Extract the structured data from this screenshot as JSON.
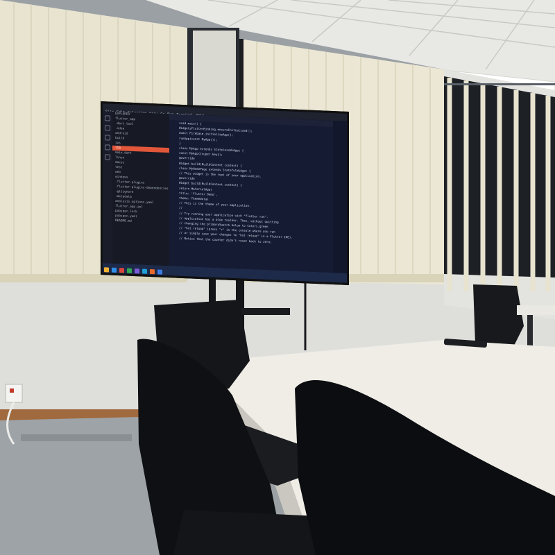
{
  "scene": {
    "description_colors": {
      "ceiling": "#e6e6e3",
      "wall": "#dcdcd8",
      "blinds": "#e8e3cf",
      "floor": "#9ea3a7",
      "table": "#efede6",
      "chair": "#111214",
      "baseboard": "#a0683c"
    }
  },
  "tv": {
    "menu": [
      "File",
      "Edit",
      "Selection",
      "View",
      "Go",
      "Run",
      "Terminal",
      "Help"
    ],
    "explorer_items": [
      "EXPLORER",
      "flutter_app",
      ".dart_tool",
      ".idea",
      "android",
      "build",
      "ios",
      "lib",
      "main.dart",
      "linux",
      "macos",
      "test",
      "web",
      "windows",
      ".flutter-plugins",
      ".flutter-plugins-dependencies",
      ".gitignore",
      ".metadata",
      "analysis_options.yaml",
      "flutter_app.iml",
      "pubspec.lock",
      "pubspec.yaml",
      "README.md"
    ],
    "code_lines": [
      {
        "cls": "k",
        "text": "void main() {"
      },
      {
        "cls": "f",
        "text": "  WidgetsFlutterBinding.ensureInitialized();"
      },
      {
        "cls": "f",
        "text": "  await Firebase.initializeApp();"
      },
      {
        "cls": "t",
        "text": "  runApp(const MyApp());"
      },
      {
        "cls": "k",
        "text": "}"
      },
      {
        "cls": "t",
        "text": "class MyApp extends StatelessWidget {"
      },
      {
        "cls": "f",
        "text": "  const MyApp({super.key});"
      },
      {
        "cls": "c",
        "text": "  @override"
      },
      {
        "cls": "t",
        "text": "  Widget build(BuildContext context) {"
      },
      {
        "cls": "t",
        "text": "class MyHomePage extends StatefulWidget {"
      },
      {
        "cls": "c",
        "text": "  // This widget is the root of your application."
      },
      {
        "cls": "c",
        "text": "  @override"
      },
      {
        "cls": "t",
        "text": "  Widget build(BuildContext context) {"
      },
      {
        "cls": "f",
        "text": "    return MaterialApp("
      },
      {
        "cls": "s",
        "text": "      title: 'Flutter Demo',"
      },
      {
        "cls": "f",
        "text": "      theme: ThemeData("
      },
      {
        "cls": "c",
        "text": "        // This is the theme of your application."
      },
      {
        "cls": "c",
        "text": "        //"
      },
      {
        "cls": "c",
        "text": "        // Try running your application with \"flutter run\"."
      },
      {
        "cls": "c",
        "text": "        // application has a blue toolbar. Then, without quitting"
      },
      {
        "cls": "c",
        "text": "        // changing the primarySwatch below to Colors.green"
      },
      {
        "cls": "c",
        "text": "        // \"hot reload\" (press \"r\" in the console where you ran"
      },
      {
        "cls": "c",
        "text": "        // or simply save your changes to \"hot reload\" in a Flutter IDE)."
      },
      {
        "cls": "c",
        "text": "        // Notice that the counter didn't reset back to zero;"
      }
    ],
    "taskbar_colors": [
      "#f2b233",
      "#2f8ee6",
      "#d9453b",
      "#33a853",
      "#7c5cd6",
      "#1fa0d6",
      "#e86a2b",
      "#3a7be0"
    ]
  }
}
